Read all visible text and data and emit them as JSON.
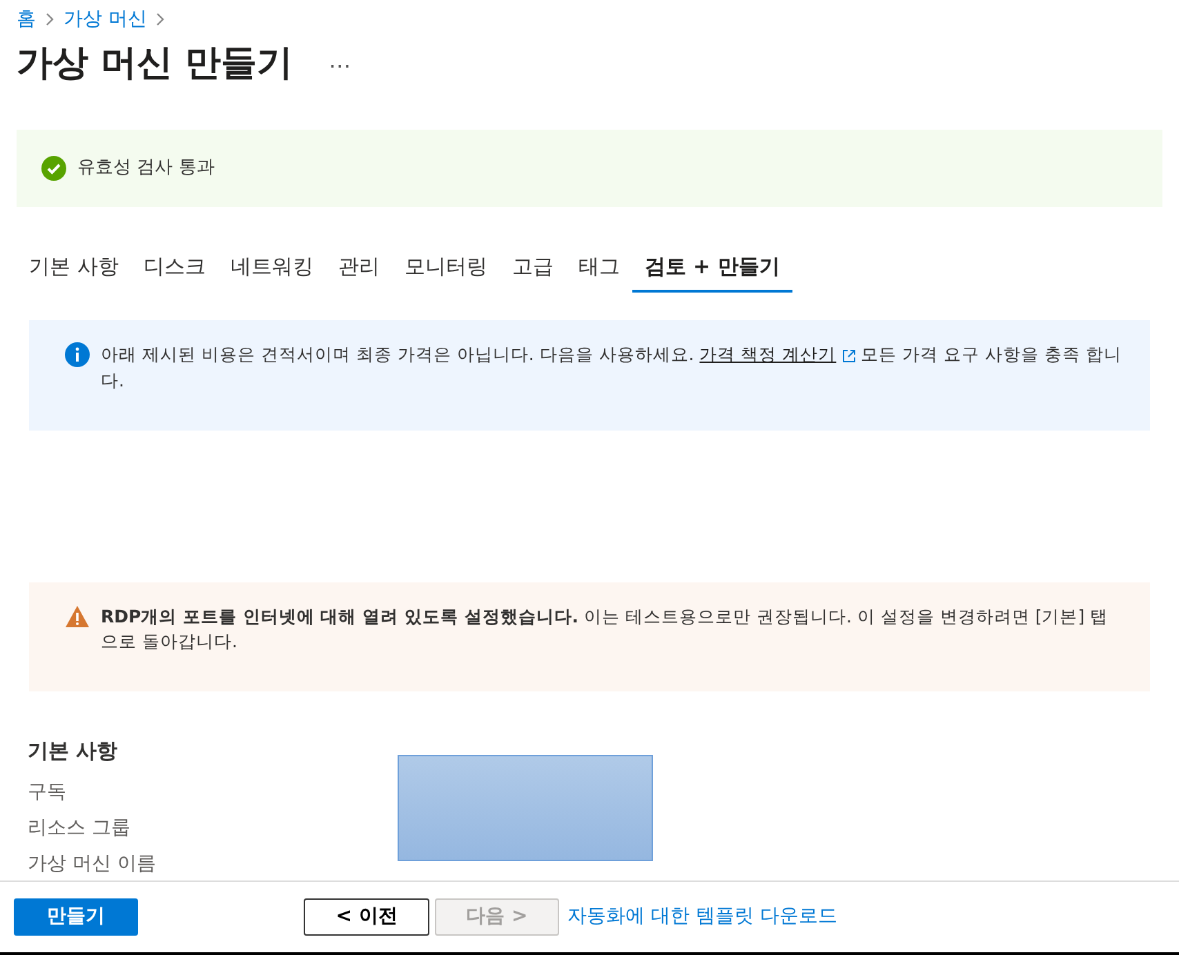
{
  "breadcrumb": [
    {
      "label": "홈"
    },
    {
      "label": "가상 머신"
    }
  ],
  "title": "가상 머신 만들기",
  "more": "…",
  "validation": {
    "passed": true,
    "text": "유효성 검사 통과"
  },
  "tabs": [
    {
      "label": "기본 사항",
      "selected": false
    },
    {
      "label": "디스크",
      "selected": false
    },
    {
      "label": "네트워킹",
      "selected": false
    },
    {
      "label": "관리",
      "selected": false
    },
    {
      "label": "모니터링",
      "selected": false
    },
    {
      "label": "고급",
      "selected": false
    },
    {
      "label": "태그",
      "selected": false
    },
    {
      "label": "검토 + 만들기",
      "selected": true
    }
  ],
  "notices": [
    {
      "kind": "info",
      "parts": [
        {
          "text": "아래 제시된 비용은 견적서이며 최종 가격은 아닙니다. 다음을 사용하세요."
        },
        {
          "link": "가격 책정 계산기"
        },
        {
          "text": "모든 가격 요구 사항을 충족 합니다."
        }
      ]
    },
    {
      "kind": "warning",
      "parts": [
        {
          "text": "**RDP개의 포트를 인터넷에 대해 열려 있도록 설정했습니다.**  이는 테스트용으로만 권장됩니다.  이 설정을 변경하려면 [기본] 탭으로 돌아갑니다."
        }
      ]
    }
  ],
  "section": {
    "title": "기본 사항",
    "fields": [
      {
        "label": "구독"
      },
      {
        "label": "리소스 그룹"
      },
      {
        "label": "가상 머신 이름"
      }
    ]
  },
  "footer": {
    "create": "만들기",
    "previous": "< 이전",
    "next": {
      "label": "다음 >",
      "disabled": true
    },
    "download": "자동화에 대한 템플릿 다운로드"
  }
}
